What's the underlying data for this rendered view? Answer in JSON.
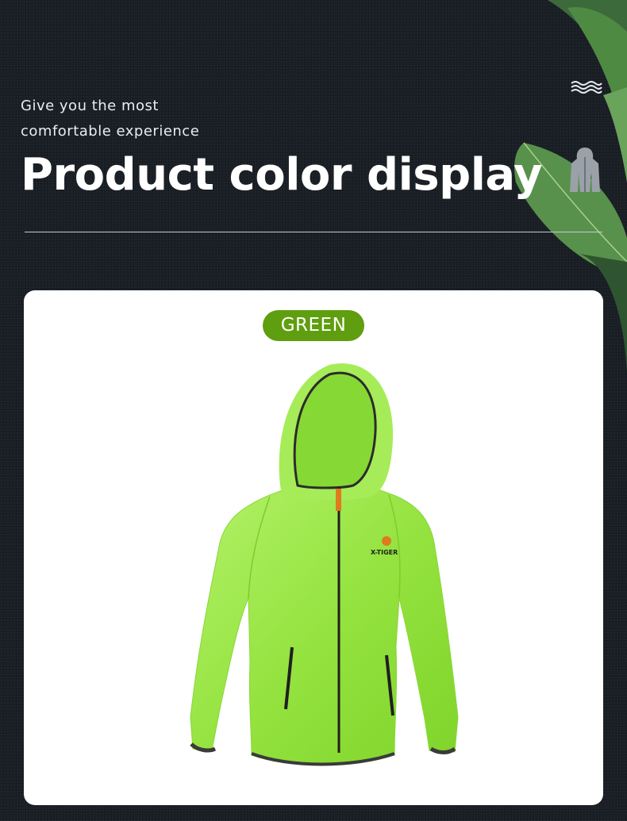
{
  "header": {
    "subtitle_line1": "Give you the most",
    "subtitle_line2": "comfortable experience",
    "title": "Product color display"
  },
  "icons": {
    "top_right_1": "waves-icon",
    "top_right_2": "hooded-jacket-icon"
  },
  "product": {
    "color_label": "GREEN",
    "brand_mark": "X-TIGER",
    "colors": {
      "badge": "#5f9e0e",
      "jacket": "#9ae64a"
    }
  },
  "colors": {
    "background": "#1c2128",
    "card": "#ffffff",
    "title": "#ffffff"
  }
}
